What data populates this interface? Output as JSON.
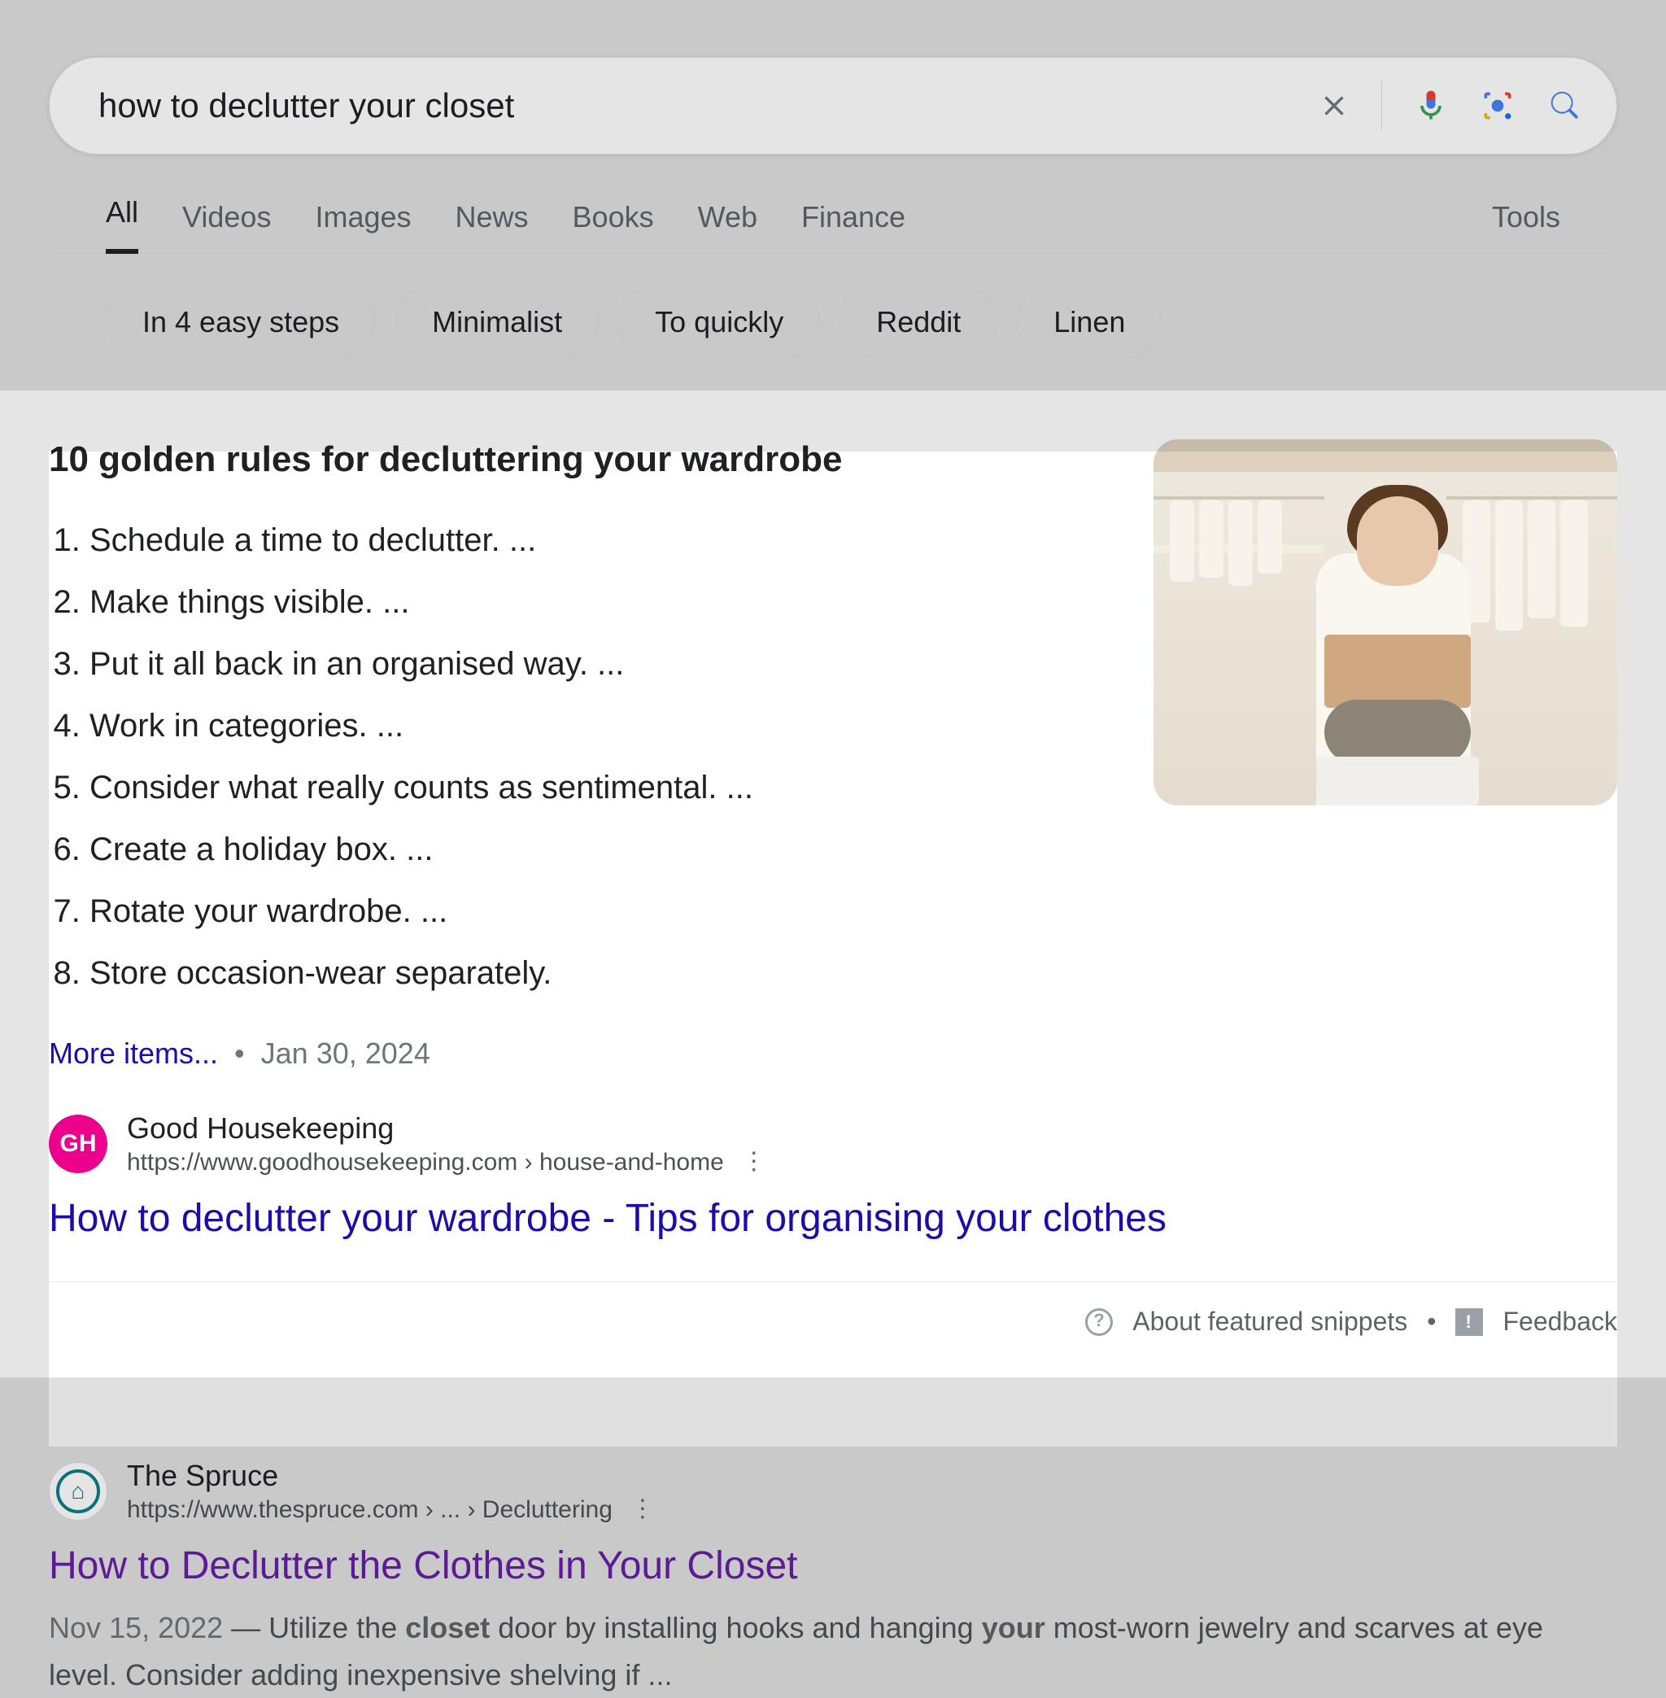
{
  "search": {
    "query": "how to declutter your closet"
  },
  "tabs": [
    "All",
    "Videos",
    "Images",
    "News",
    "Books",
    "Web",
    "Finance"
  ],
  "active_tab_index": 0,
  "tools_label": "Tools",
  "chips": [
    "In 4 easy steps",
    "Minimalist",
    "To quickly",
    "Reddit",
    "Linen"
  ],
  "featured_snippet": {
    "title": "10 golden rules for decluttering your wardrobe",
    "items": [
      "Schedule a time to declutter. ...",
      "Make things visible. ...",
      "Put it all back in an organised way. ...",
      "Work in categories. ...",
      "Consider what really counts as sentimental. ...",
      "Create a holiday box. ...",
      "Rotate your wardrobe. ...",
      "Store occasion-wear separately."
    ],
    "more_label": "More items...",
    "date": "Jan 30, 2024",
    "source": {
      "name": "Good Housekeeping",
      "url_display": "https://www.goodhousekeeping.com › house-and-home",
      "favicon_text": "GH",
      "title": "How to declutter your wardrobe - Tips for organising your clothes"
    },
    "about_label": "About featured snippets",
    "feedback_label": "Feedback"
  },
  "results": [
    {
      "site_name": "The Spruce",
      "url_display": "https://www.thespruce.com › ... › Decluttering",
      "title": "How to Declutter the Clothes in Your Closet",
      "visited": true,
      "snippet_date": "Nov 15, 2022",
      "snippet_before": " — Utilize the ",
      "snippet_em1": "closet",
      "snippet_mid": " door by installing hooks and hanging ",
      "snippet_em2": "your",
      "snippet_after": " most-worn jewelry and scarves at eye level. Consider adding inexpensive shelving if ..."
    }
  ]
}
